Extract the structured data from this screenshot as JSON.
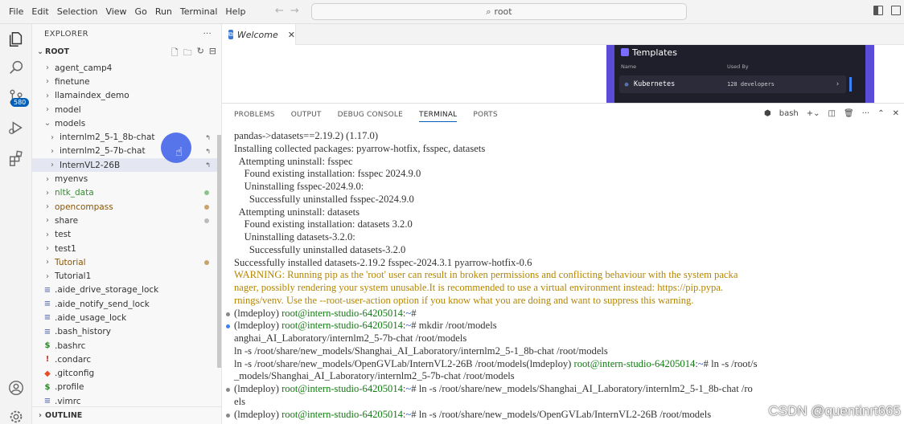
{
  "menu": [
    "File",
    "Edit",
    "Selection",
    "View",
    "Go",
    "Run",
    "Terminal",
    "Help"
  ],
  "search": {
    "text": "root"
  },
  "activity": {
    "scm_badge": "580"
  },
  "explorer": {
    "title": "EXPLORER",
    "more": "···",
    "root_label": "ROOT",
    "outline_label": "OUTLINE",
    "tree": [
      {
        "name": "agent_camp4",
        "type": "folder",
        "indent": 1,
        "color": "#333333"
      },
      {
        "name": "finetune",
        "type": "folder",
        "indent": 1,
        "color": "#333333"
      },
      {
        "name": "llamaindex_demo",
        "type": "folder",
        "indent": 1,
        "color": "#333333"
      },
      {
        "name": "model",
        "type": "folder",
        "indent": 1,
        "color": "#333333"
      },
      {
        "name": "models",
        "type": "folder-open",
        "indent": 1,
        "color": "#333333"
      },
      {
        "name": "internlm2_5-1_8b-chat",
        "type": "folder",
        "indent": 2,
        "color": "#333333",
        "link": true
      },
      {
        "name": "internlm2_5-7b-chat",
        "type": "folder",
        "indent": 2,
        "color": "#333333",
        "link": true
      },
      {
        "name": "InternVL2-26B",
        "type": "folder",
        "indent": 2,
        "color": "#333333",
        "link": true,
        "selected": true
      },
      {
        "name": "myenvs",
        "type": "folder",
        "indent": 1,
        "color": "#333333"
      },
      {
        "name": "nltk_data",
        "type": "folder",
        "indent": 1,
        "color": "#388a34",
        "dot": "#8ec28a"
      },
      {
        "name": "opencompass",
        "type": "folder",
        "indent": 1,
        "color": "#895503",
        "dot": "#c9a26d"
      },
      {
        "name": "share",
        "type": "folder",
        "indent": 1,
        "color": "#333333",
        "dot": "#bbbbbb"
      },
      {
        "name": "test",
        "type": "folder",
        "indent": 1,
        "color": "#333333"
      },
      {
        "name": "test1",
        "type": "folder",
        "indent": 1,
        "color": "#333333"
      },
      {
        "name": "Tutorial",
        "type": "folder",
        "indent": 1,
        "color": "#895503",
        "dot": "#c9a26d"
      },
      {
        "name": "Tutorial1",
        "type": "folder",
        "indent": 1,
        "color": "#333333"
      },
      {
        "name": ".aide_drive_storage_lock",
        "type": "file",
        "indent": 1,
        "color": "#333333"
      },
      {
        "name": ".aide_notify_send_lock",
        "type": "file",
        "indent": 1,
        "color": "#333333"
      },
      {
        "name": ".aide_usage_lock",
        "type": "file",
        "indent": 1,
        "color": "#333333"
      },
      {
        "name": ".bash_history",
        "type": "file",
        "indent": 1,
        "color": "#333333"
      },
      {
        "name": ".bashrc",
        "type": "shell",
        "indent": 1,
        "color": "#333333"
      },
      {
        "name": ".condarc",
        "type": "bang",
        "indent": 1,
        "color": "#333333"
      },
      {
        "name": ".gitconfig",
        "type": "git",
        "indent": 1,
        "color": "#333333"
      },
      {
        "name": ".profile",
        "type": "shell",
        "indent": 1,
        "color": "#333333"
      },
      {
        "name": ".vimrc",
        "type": "file",
        "indent": 1,
        "color": "#333333"
      }
    ]
  },
  "tab": {
    "label": "Welcome"
  },
  "templates": {
    "title": "Templates",
    "col_name": "Name",
    "col_used": "Used By",
    "item_name": "Kubernetes",
    "item_used": "128 developers"
  },
  "panel": {
    "tabs": [
      "PROBLEMS",
      "OUTPUT",
      "DEBUG CONSOLE",
      "TERMINAL",
      "PORTS"
    ],
    "active_tab": "TERMINAL",
    "shell": "bash"
  },
  "terminal": [
    {
      "segs": [
        {
          "t": "pandas->datasets==2.19.2) (1.17.0)"
        }
      ]
    },
    {
      "segs": [
        {
          "t": "Installing collected packages: pyarrow-hotfix, fsspec, datasets"
        }
      ]
    },
    {
      "segs": [
        {
          "t": "  Attempting uninstall: fsspec"
        }
      ]
    },
    {
      "segs": [
        {
          "t": "    Found existing installation: fsspec 2024.9.0"
        }
      ]
    },
    {
      "segs": [
        {
          "t": "    Uninstalling fsspec-2024.9.0:"
        }
      ]
    },
    {
      "segs": [
        {
          "t": "      Successfully uninstalled fsspec-2024.9.0"
        }
      ]
    },
    {
      "segs": [
        {
          "t": "  Attempting uninstall: datasets"
        }
      ]
    },
    {
      "segs": [
        {
          "t": "    Found existing installation: datasets 3.2.0"
        }
      ]
    },
    {
      "segs": [
        {
          "t": "    Uninstalling datasets-3.2.0:"
        }
      ]
    },
    {
      "segs": [
        {
          "t": "      Successfully uninstalled datasets-3.2.0"
        }
      ]
    },
    {
      "segs": [
        {
          "t": "Successfully installed datasets-2.19.2 fsspec-2024.3.1 pyarrow-hotfix-0.6"
        }
      ]
    },
    {
      "segs": [
        {
          "t": "WARNING: Running pip as the 'root' user can result in broken permissions and conflicting behaviour with the system packa",
          "c": "warn"
        }
      ]
    },
    {
      "segs": [
        {
          "t": "nager, possibly rendering your system unusable.It is recommended to use a virtual environment instead: https://pip.pypa.",
          "c": "warn"
        }
      ]
    },
    {
      "segs": [
        {
          "t": "rnings/venv. Use the --root-user-action option if you know what you are doing and want to suppress this warning.",
          "c": "warn"
        }
      ]
    },
    {
      "mark": "#888888",
      "segs": [
        {
          "t": "(lmdeploy) "
        },
        {
          "t": "root@intern-studio-64205014",
          "c": "user"
        },
        {
          "t": ":"
        },
        {
          "t": "~",
          "c": "path"
        },
        {
          "t": "#"
        }
      ]
    },
    {
      "mark": "#3b82f6",
      "segs": [
        {
          "t": "(lmdeploy) "
        },
        {
          "t": "root@intern-studio-64205014",
          "c": "user"
        },
        {
          "t": ":"
        },
        {
          "t": "~",
          "c": "path"
        },
        {
          "t": "# mkdir /root/models"
        }
      ]
    },
    {
      "segs": [
        {
          "t": "anghai_AI_Laboratory/internlm2_5-7b-chat /root/models"
        }
      ]
    },
    {
      "segs": [
        {
          "t": "ln -s /root/share/new_models/Shanghai_AI_Laboratory/internlm2_5-1_8b-chat /root/models"
        }
      ]
    },
    {
      "segs": [
        {
          "t": "ln -s /root/share/new_models/OpenGVLab/InternVL2-26B /root/models(lmdeploy) "
        },
        {
          "t": "root@intern-studio-64205014",
          "c": "user"
        },
        {
          "t": ":"
        },
        {
          "t": "~",
          "c": "path"
        },
        {
          "t": "# ln -s /root/s"
        }
      ]
    },
    {
      "segs": [
        {
          "t": "_models/Shanghai_AI_Laboratory/internlm2_5-7b-chat /root/models"
        }
      ]
    },
    {
      "mark": "#888888",
      "segs": [
        {
          "t": "(lmdeploy) "
        },
        {
          "t": "root@intern-studio-64205014",
          "c": "user"
        },
        {
          "t": ":"
        },
        {
          "t": "~",
          "c": "path"
        },
        {
          "t": "# ln -s /root/share/new_models/Shanghai_AI_Laboratory/internlm2_5-1_8b-chat /ro"
        }
      ]
    },
    {
      "segs": [
        {
          "t": "els"
        }
      ]
    },
    {
      "mark": "#888888",
      "segs": [
        {
          "t": "(lmdeploy) "
        },
        {
          "t": "root@intern-studio-64205014",
          "c": "user"
        },
        {
          "t": ":"
        },
        {
          "t": "~",
          "c": "path"
        },
        {
          "t": "# ln -s /root/share/new_models/OpenGVLab/InternVL2-26B /root/models"
        }
      ]
    }
  ],
  "watermark": "CSDN @quentinrt665"
}
